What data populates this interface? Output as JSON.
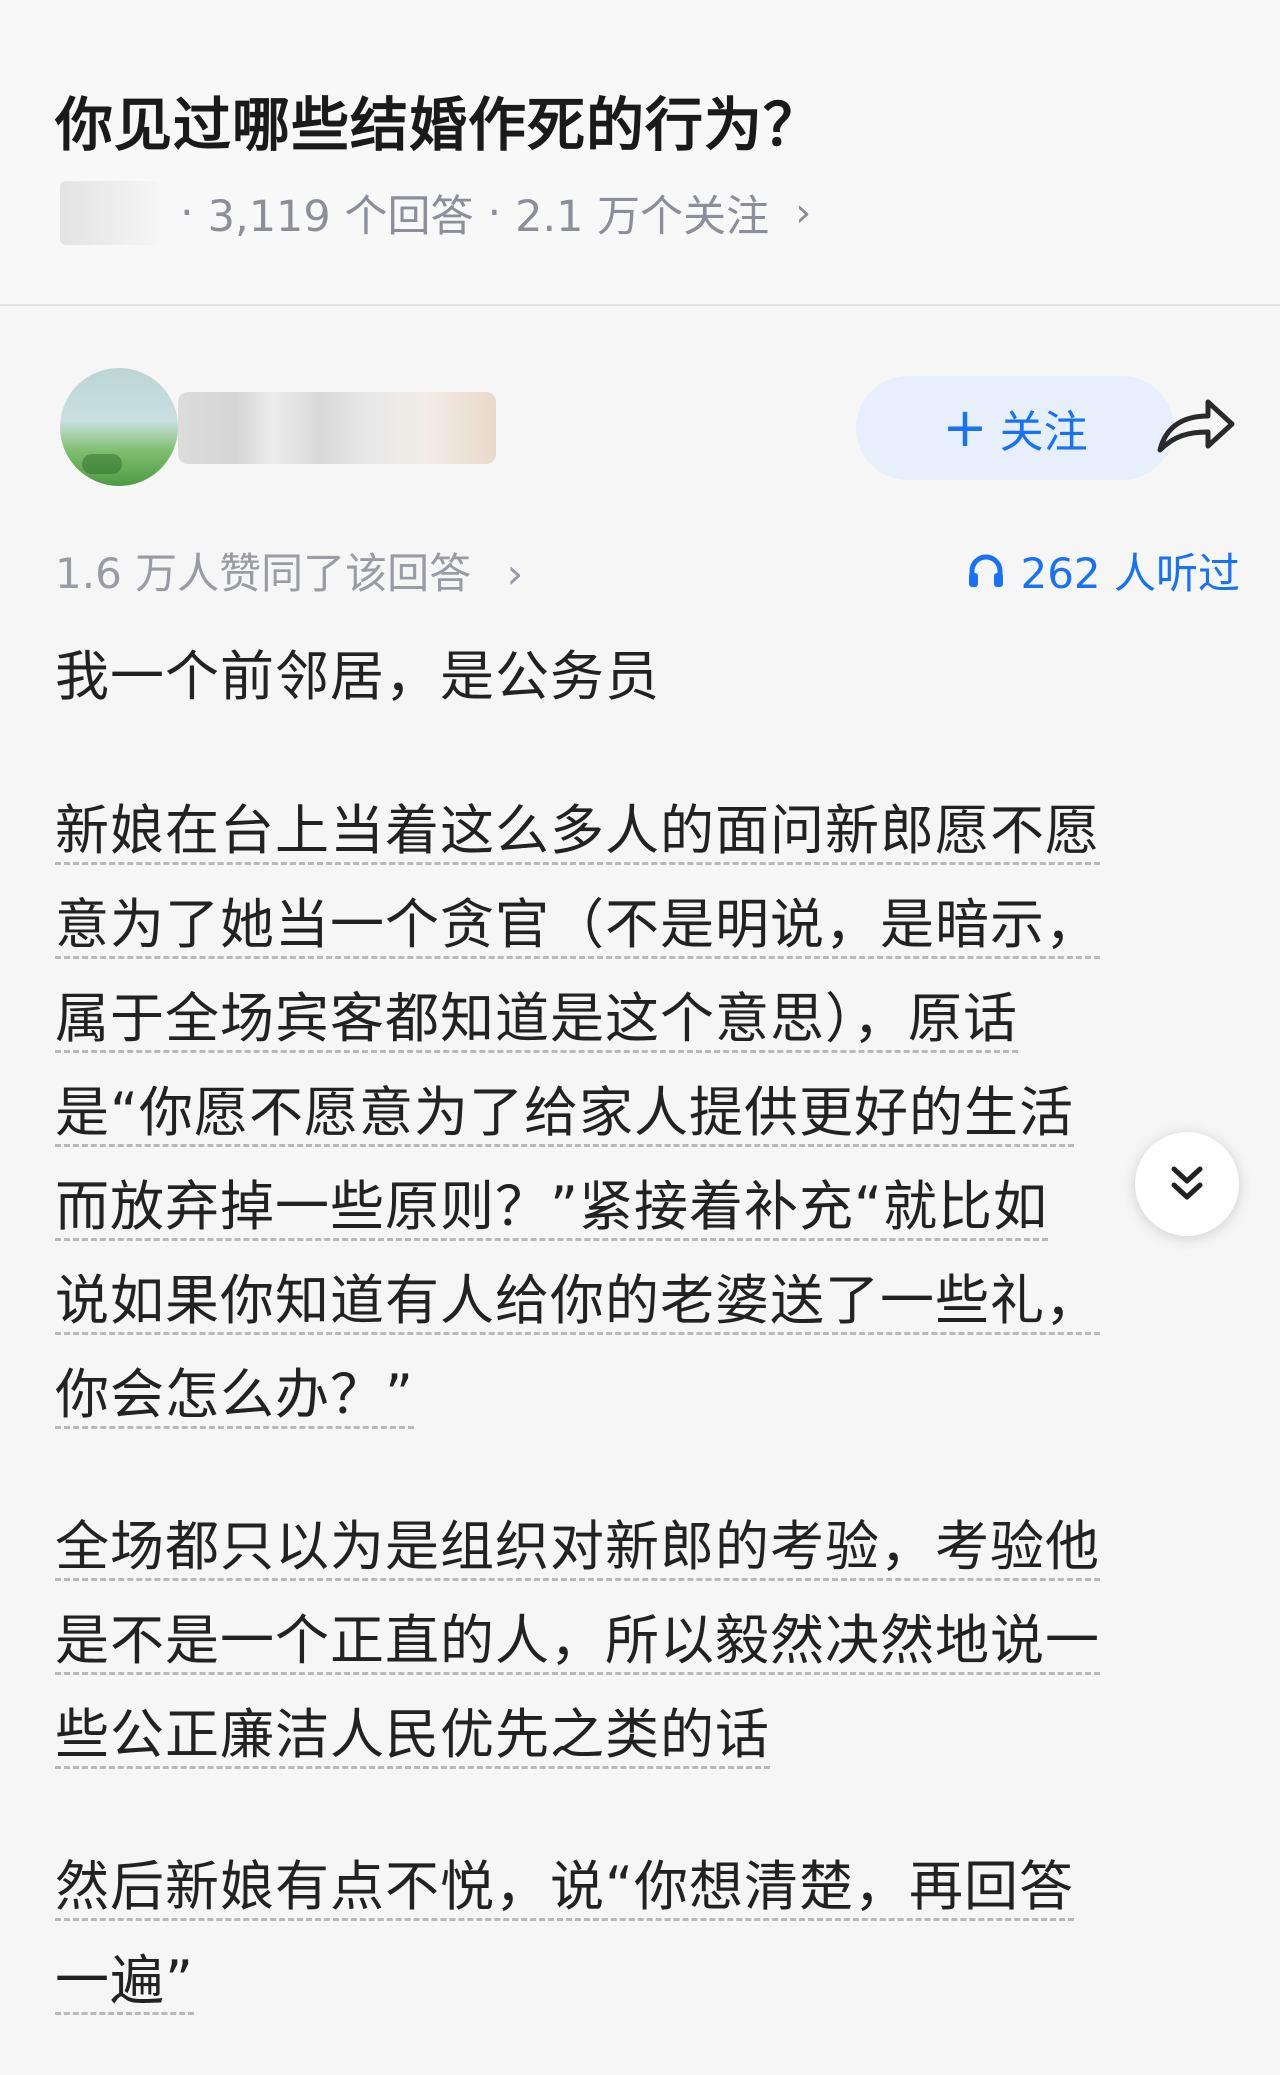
{
  "question": {
    "title": "你见过哪些结婚作死的行为？",
    "answers": "3,119 个回答",
    "followers": "2.1 万个关注",
    "chevron": "›"
  },
  "answer": {
    "follow_label": "关注",
    "follow_plus": "+",
    "agree_text": "1.6 万人赞同了该回答",
    "agree_chevron": "›",
    "listen_text": "262 人听过",
    "paragraphs": [
      [
        "我一个前邻居，是公务员"
      ],
      [
        "新娘在台上当着这么多人的面问新郎愿不愿",
        "意为了她当一个贪官（不是明说，是暗示，",
        "属于全场宾客都知道是这个意思），原话",
        "是“你愿不愿意为了给家人提供更好的生活",
        "而放弃掉一些原则？”紧接着补充“就比如",
        "说如果你知道有人给你的老婆送了一些礼，",
        "你会怎么办？”"
      ],
      [
        "全场都只以为是组织对新郎的考验，考验他",
        "是不是一个正直的人，所以毅然决然地说一",
        "些公正廉洁人民优先之类的话"
      ],
      [
        "然后新娘有点不悦，说“你想清楚，再回答",
        "一遍”"
      ]
    ]
  },
  "colors": {
    "accent": "#1772f6",
    "muted": "#9a9ca5",
    "follow_bg": "#e6effb"
  },
  "icons": [
    "share-arrow-icon",
    "headphones-icon",
    "chevron-down-double-icon"
  ]
}
